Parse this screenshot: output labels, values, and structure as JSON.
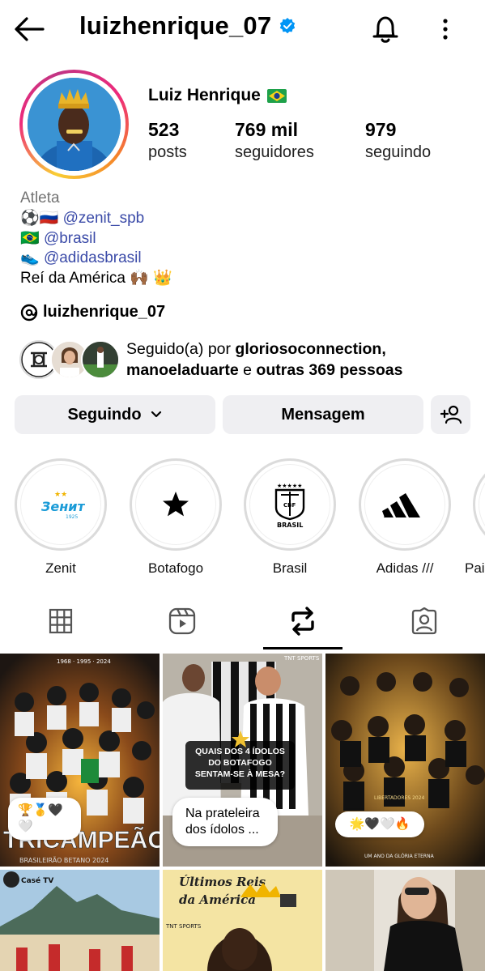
{
  "header": {
    "username": "luizhenrique_07",
    "verified": true
  },
  "profile": {
    "full_name": "Luiz Henrique",
    "name_flag": "brazil-flag",
    "stats": [
      {
        "value": "523",
        "label": "posts"
      },
      {
        "value": "769 mil",
        "label": "seguidores"
      },
      {
        "value": "979",
        "label": "seguindo"
      }
    ],
    "category": "Atleta",
    "bio_lines": [
      {
        "prefix": "⚽🇷🇺 ",
        "mention": "@zenit_spb"
      },
      {
        "prefix": "🇧🇷 ",
        "mention": "@brasil"
      },
      {
        "prefix": "👟 ",
        "mention": "@adidasbrasil"
      }
    ],
    "bio_last": "Reí da América 🙌🏾 👑",
    "threads_handle": "luizhenrique_07",
    "followed_by": {
      "prefix": "Seguido(a) por",
      "user1": "gloriosoconnection,",
      "user2": "manoeladuarte",
      "joiner": "e",
      "others": "outras 369 pessoas"
    }
  },
  "actions": {
    "following_label": "Seguindo",
    "message_label": "Mensagem"
  },
  "highlights": [
    {
      "label": "Zenit",
      "icon": "zenit-logo"
    },
    {
      "label": "Botafogo",
      "icon": "star-icon"
    },
    {
      "label": "Brasil",
      "icon": "cbf-crest",
      "crest_text": "BRASIL"
    },
    {
      "label": "Adidas ///",
      "icon": "adidas-logo"
    },
    {
      "label": "Pai",
      "icon": "partial"
    }
  ],
  "tabs": [
    {
      "name": "grid",
      "icon": "grid-icon"
    },
    {
      "name": "reels",
      "icon": "reels-icon"
    },
    {
      "name": "reposts",
      "icon": "repost-icon",
      "active": true
    },
    {
      "name": "tagged",
      "icon": "tagged-icon"
    }
  ],
  "posts": [
    {
      "caption_big": "TRICAMPEÃO",
      "caption_small": "BRASILEIRÃO BETANO 2024",
      "top_text": "1968 · 1995 · 2024",
      "reactions": "🏆🥇🖤🤍"
    },
    {
      "headline": "QUAIS DOS 4 ÍDOLOS DO BOTAFOGO SENTAM-SE À MESA?",
      "bubble": "Na prateleira dos ídolos ...",
      "brand": "TNT SPORTS"
    },
    {
      "reactions": "🌟🖤🤍🔥",
      "top_text": "LIBERTADORES 2024",
      "bottom_text": "UM ANO DA GLÓRIA ETERNA"
    },
    {
      "logo": "Casé TV"
    },
    {
      "script_text": "Últimos Reis da América",
      "brand": "TNT SPORTS"
    },
    {}
  ],
  "colors": {
    "mention": "#3b4ba8",
    "verified": "#0095f6",
    "button_bg": "#efeff2",
    "category": "#737373"
  }
}
